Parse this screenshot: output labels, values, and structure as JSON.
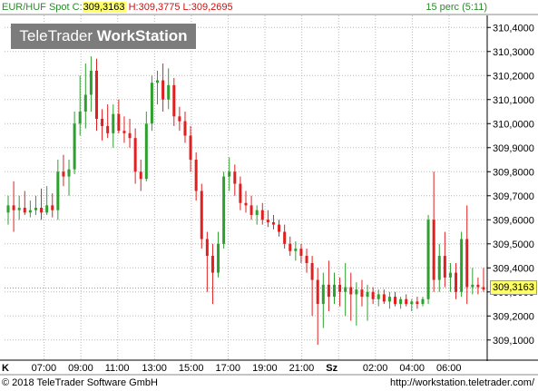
{
  "header": {
    "symbol": "EUR/HUF Spot",
    "close_label": "C:",
    "close_value": "309,3163",
    "high_label": "H:",
    "high_value": "309,3775",
    "low_label": "L:",
    "low_value": "309,2695",
    "interval": "15 perc (5:11)"
  },
  "logo": {
    "text_regular": "TeleTrader ",
    "text_bold": "WorkStation"
  },
  "footer": {
    "copyright": "© 2018 TeleTrader Software GmbH",
    "url": "http://workstation.teletrader.com/"
  },
  "colors": {
    "up": "#2ea02e",
    "down": "#e02020",
    "grid": "#b8b8b8",
    "axis": "#000000",
    "last_price_bg": "#ffff66"
  },
  "chart_data": {
    "type": "candlestick",
    "title": "EUR/HUF Spot",
    "last_price": "309,3163",
    "y_axis": {
      "ticks": [
        "310,4000",
        "310,3000",
        "310,2000",
        "310,1000",
        "310,0000",
        "309,9000",
        "309,8000",
        "309,7000",
        "309,6000",
        "309,5000",
        "309,4000",
        "309,3000",
        "309,2000",
        "309,1000"
      ],
      "range": [
        309.02,
        310.45
      ]
    },
    "x_axis": {
      "ticks": [
        "K",
        "07:00",
        "09:00",
        "11:00",
        "13:00",
        "15:00",
        "17:00",
        "19:00",
        "21:00",
        "Sz",
        "02:00",
        "04:00",
        "06:00"
      ]
    },
    "grid": true,
    "candles": [
      {
        "o": 309.63,
        "h": 309.7,
        "l": 309.58,
        "c": 309.66
      },
      {
        "o": 309.66,
        "h": 309.76,
        "l": 309.55,
        "c": 309.64
      },
      {
        "o": 309.64,
        "h": 309.7,
        "l": 309.6,
        "c": 309.65
      },
      {
        "o": 309.65,
        "h": 309.72,
        "l": 309.62,
        "c": 309.63
      },
      {
        "o": 309.63,
        "h": 309.68,
        "l": 309.61,
        "c": 309.64
      },
      {
        "o": 309.64,
        "h": 309.7,
        "l": 309.62,
        "c": 309.65
      },
      {
        "o": 309.65,
        "h": 309.73,
        "l": 309.6,
        "c": 309.63
      },
      {
        "o": 309.63,
        "h": 309.74,
        "l": 309.62,
        "c": 309.66
      },
      {
        "o": 309.66,
        "h": 309.71,
        "l": 309.61,
        "c": 309.64
      },
      {
        "o": 309.64,
        "h": 309.85,
        "l": 309.6,
        "c": 309.8
      },
      {
        "o": 309.8,
        "h": 309.87,
        "l": 309.74,
        "c": 309.78
      },
      {
        "o": 309.78,
        "h": 309.85,
        "l": 309.7,
        "c": 309.81
      },
      {
        "o": 309.81,
        "h": 310.05,
        "l": 309.79,
        "c": 310.0
      },
      {
        "o": 310.0,
        "h": 310.2,
        "l": 309.95,
        "c": 310.05
      },
      {
        "o": 310.05,
        "h": 310.25,
        "l": 309.98,
        "c": 310.12
      },
      {
        "o": 310.12,
        "h": 310.28,
        "l": 310.05,
        "c": 310.22
      },
      {
        "o": 310.22,
        "h": 310.27,
        "l": 309.97,
        "c": 310.02
      },
      {
        "o": 310.02,
        "h": 310.06,
        "l": 309.93,
        "c": 309.99
      },
      {
        "o": 309.99,
        "h": 310.08,
        "l": 309.94,
        "c": 309.96
      },
      {
        "o": 309.96,
        "h": 310.08,
        "l": 309.9,
        "c": 310.04
      },
      {
        "o": 310.04,
        "h": 310.1,
        "l": 309.96,
        "c": 309.97
      },
      {
        "o": 309.97,
        "h": 310.03,
        "l": 309.92,
        "c": 309.96
      },
      {
        "o": 309.96,
        "h": 310.02,
        "l": 309.9,
        "c": 309.94
      },
      {
        "o": 309.94,
        "h": 309.98,
        "l": 309.75,
        "c": 309.8
      },
      {
        "o": 309.8,
        "h": 309.85,
        "l": 309.72,
        "c": 309.77
      },
      {
        "o": 309.77,
        "h": 310.05,
        "l": 309.76,
        "c": 310.0
      },
      {
        "o": 310.0,
        "h": 310.2,
        "l": 309.97,
        "c": 310.17
      },
      {
        "o": 310.17,
        "h": 310.22,
        "l": 310.08,
        "c": 310.18
      },
      {
        "o": 310.18,
        "h": 310.25,
        "l": 310.05,
        "c": 310.1
      },
      {
        "o": 310.1,
        "h": 310.23,
        "l": 310.06,
        "c": 310.16
      },
      {
        "o": 310.16,
        "h": 310.19,
        "l": 309.99,
        "c": 310.03
      },
      {
        "o": 310.03,
        "h": 310.07,
        "l": 309.97,
        "c": 310.01
      },
      {
        "o": 310.01,
        "h": 310.05,
        "l": 309.92,
        "c": 309.95
      },
      {
        "o": 309.95,
        "h": 309.99,
        "l": 309.8,
        "c": 309.85
      },
      {
        "o": 309.85,
        "h": 309.88,
        "l": 309.68,
        "c": 309.72
      },
      {
        "o": 309.72,
        "h": 309.75,
        "l": 309.48,
        "c": 309.52
      },
      {
        "o": 309.52,
        "h": 309.55,
        "l": 309.3,
        "c": 309.45
      },
      {
        "o": 309.45,
        "h": 309.5,
        "l": 309.25,
        "c": 309.38
      },
      {
        "o": 309.38,
        "h": 309.55,
        "l": 309.36,
        "c": 309.5
      },
      {
        "o": 309.5,
        "h": 309.8,
        "l": 309.48,
        "c": 309.78
      },
      {
        "o": 309.78,
        "h": 309.86,
        "l": 309.72,
        "c": 309.8
      },
      {
        "o": 309.8,
        "h": 309.83,
        "l": 309.7,
        "c": 309.75
      },
      {
        "o": 309.75,
        "h": 309.78,
        "l": 309.64,
        "c": 309.67
      },
      {
        "o": 309.67,
        "h": 309.72,
        "l": 309.63,
        "c": 309.66
      },
      {
        "o": 309.66,
        "h": 309.7,
        "l": 309.6,
        "c": 309.62
      },
      {
        "o": 309.62,
        "h": 309.66,
        "l": 309.58,
        "c": 309.64
      },
      {
        "o": 309.64,
        "h": 309.67,
        "l": 309.58,
        "c": 309.6
      },
      {
        "o": 309.6,
        "h": 309.64,
        "l": 309.57,
        "c": 309.59
      },
      {
        "o": 309.59,
        "h": 309.62,
        "l": 309.56,
        "c": 309.58
      },
      {
        "o": 309.58,
        "h": 309.6,
        "l": 309.53,
        "c": 309.55
      },
      {
        "o": 309.55,
        "h": 309.58,
        "l": 309.48,
        "c": 309.5
      },
      {
        "o": 309.5,
        "h": 309.53,
        "l": 309.45,
        "c": 309.47
      },
      {
        "o": 309.47,
        "h": 309.51,
        "l": 309.43,
        "c": 309.48
      },
      {
        "o": 309.48,
        "h": 309.5,
        "l": 309.42,
        "c": 309.45
      },
      {
        "o": 309.45,
        "h": 309.48,
        "l": 309.38,
        "c": 309.42
      },
      {
        "o": 309.42,
        "h": 309.45,
        "l": 309.2,
        "c": 309.35
      },
      {
        "o": 309.35,
        "h": 309.4,
        "l": 309.08,
        "c": 309.25
      },
      {
        "o": 309.25,
        "h": 309.38,
        "l": 309.15,
        "c": 309.33
      },
      {
        "o": 309.33,
        "h": 309.43,
        "l": 309.22,
        "c": 309.28
      },
      {
        "o": 309.28,
        "h": 309.38,
        "l": 309.25,
        "c": 309.33
      },
      {
        "o": 309.33,
        "h": 309.36,
        "l": 309.24,
        "c": 309.3
      },
      {
        "o": 309.3,
        "h": 309.42,
        "l": 309.2,
        "c": 309.32
      },
      {
        "o": 309.32,
        "h": 309.38,
        "l": 309.18,
        "c": 309.29
      },
      {
        "o": 309.29,
        "h": 309.34,
        "l": 309.16,
        "c": 309.31
      },
      {
        "o": 309.31,
        "h": 309.35,
        "l": 309.24,
        "c": 309.28
      },
      {
        "o": 309.28,
        "h": 309.33,
        "l": 309.18,
        "c": 309.3
      },
      {
        "o": 309.3,
        "h": 309.32,
        "l": 309.25,
        "c": 309.27
      },
      {
        "o": 309.27,
        "h": 309.31,
        "l": 309.24,
        "c": 309.29
      },
      {
        "o": 309.29,
        "h": 309.31,
        "l": 309.25,
        "c": 309.26
      },
      {
        "o": 309.26,
        "h": 309.3,
        "l": 309.23,
        "c": 309.28
      },
      {
        "o": 309.28,
        "h": 309.3,
        "l": 309.24,
        "c": 309.25
      },
      {
        "o": 309.25,
        "h": 309.28,
        "l": 309.23,
        "c": 309.27
      },
      {
        "o": 309.27,
        "h": 309.29,
        "l": 309.24,
        "c": 309.25
      },
      {
        "o": 309.25,
        "h": 309.27,
        "l": 309.22,
        "c": 309.26
      },
      {
        "o": 309.26,
        "h": 309.28,
        "l": 309.23,
        "c": 309.25
      },
      {
        "o": 309.25,
        "h": 309.28,
        "l": 309.24,
        "c": 309.27
      },
      {
        "o": 309.27,
        "h": 309.62,
        "l": 309.25,
        "c": 309.6
      },
      {
        "o": 309.6,
        "h": 309.8,
        "l": 309.3,
        "c": 309.35
      },
      {
        "o": 309.35,
        "h": 309.5,
        "l": 309.3,
        "c": 309.45
      },
      {
        "o": 309.45,
        "h": 309.55,
        "l": 309.32,
        "c": 309.36
      },
      {
        "o": 309.36,
        "h": 309.42,
        "l": 309.3,
        "c": 309.38
      },
      {
        "o": 309.38,
        "h": 309.42,
        "l": 309.27,
        "c": 309.3
      },
      {
        "o": 309.3,
        "h": 309.55,
        "l": 309.28,
        "c": 309.52
      },
      {
        "o": 309.52,
        "h": 309.66,
        "l": 309.25,
        "c": 309.32
      },
      {
        "o": 309.32,
        "h": 309.4,
        "l": 309.29,
        "c": 309.33
      },
      {
        "o": 309.33,
        "h": 309.36,
        "l": 309.29,
        "c": 309.32
      },
      {
        "o": 309.32,
        "h": 309.4,
        "l": 309.3,
        "c": 309.31
      }
    ]
  }
}
